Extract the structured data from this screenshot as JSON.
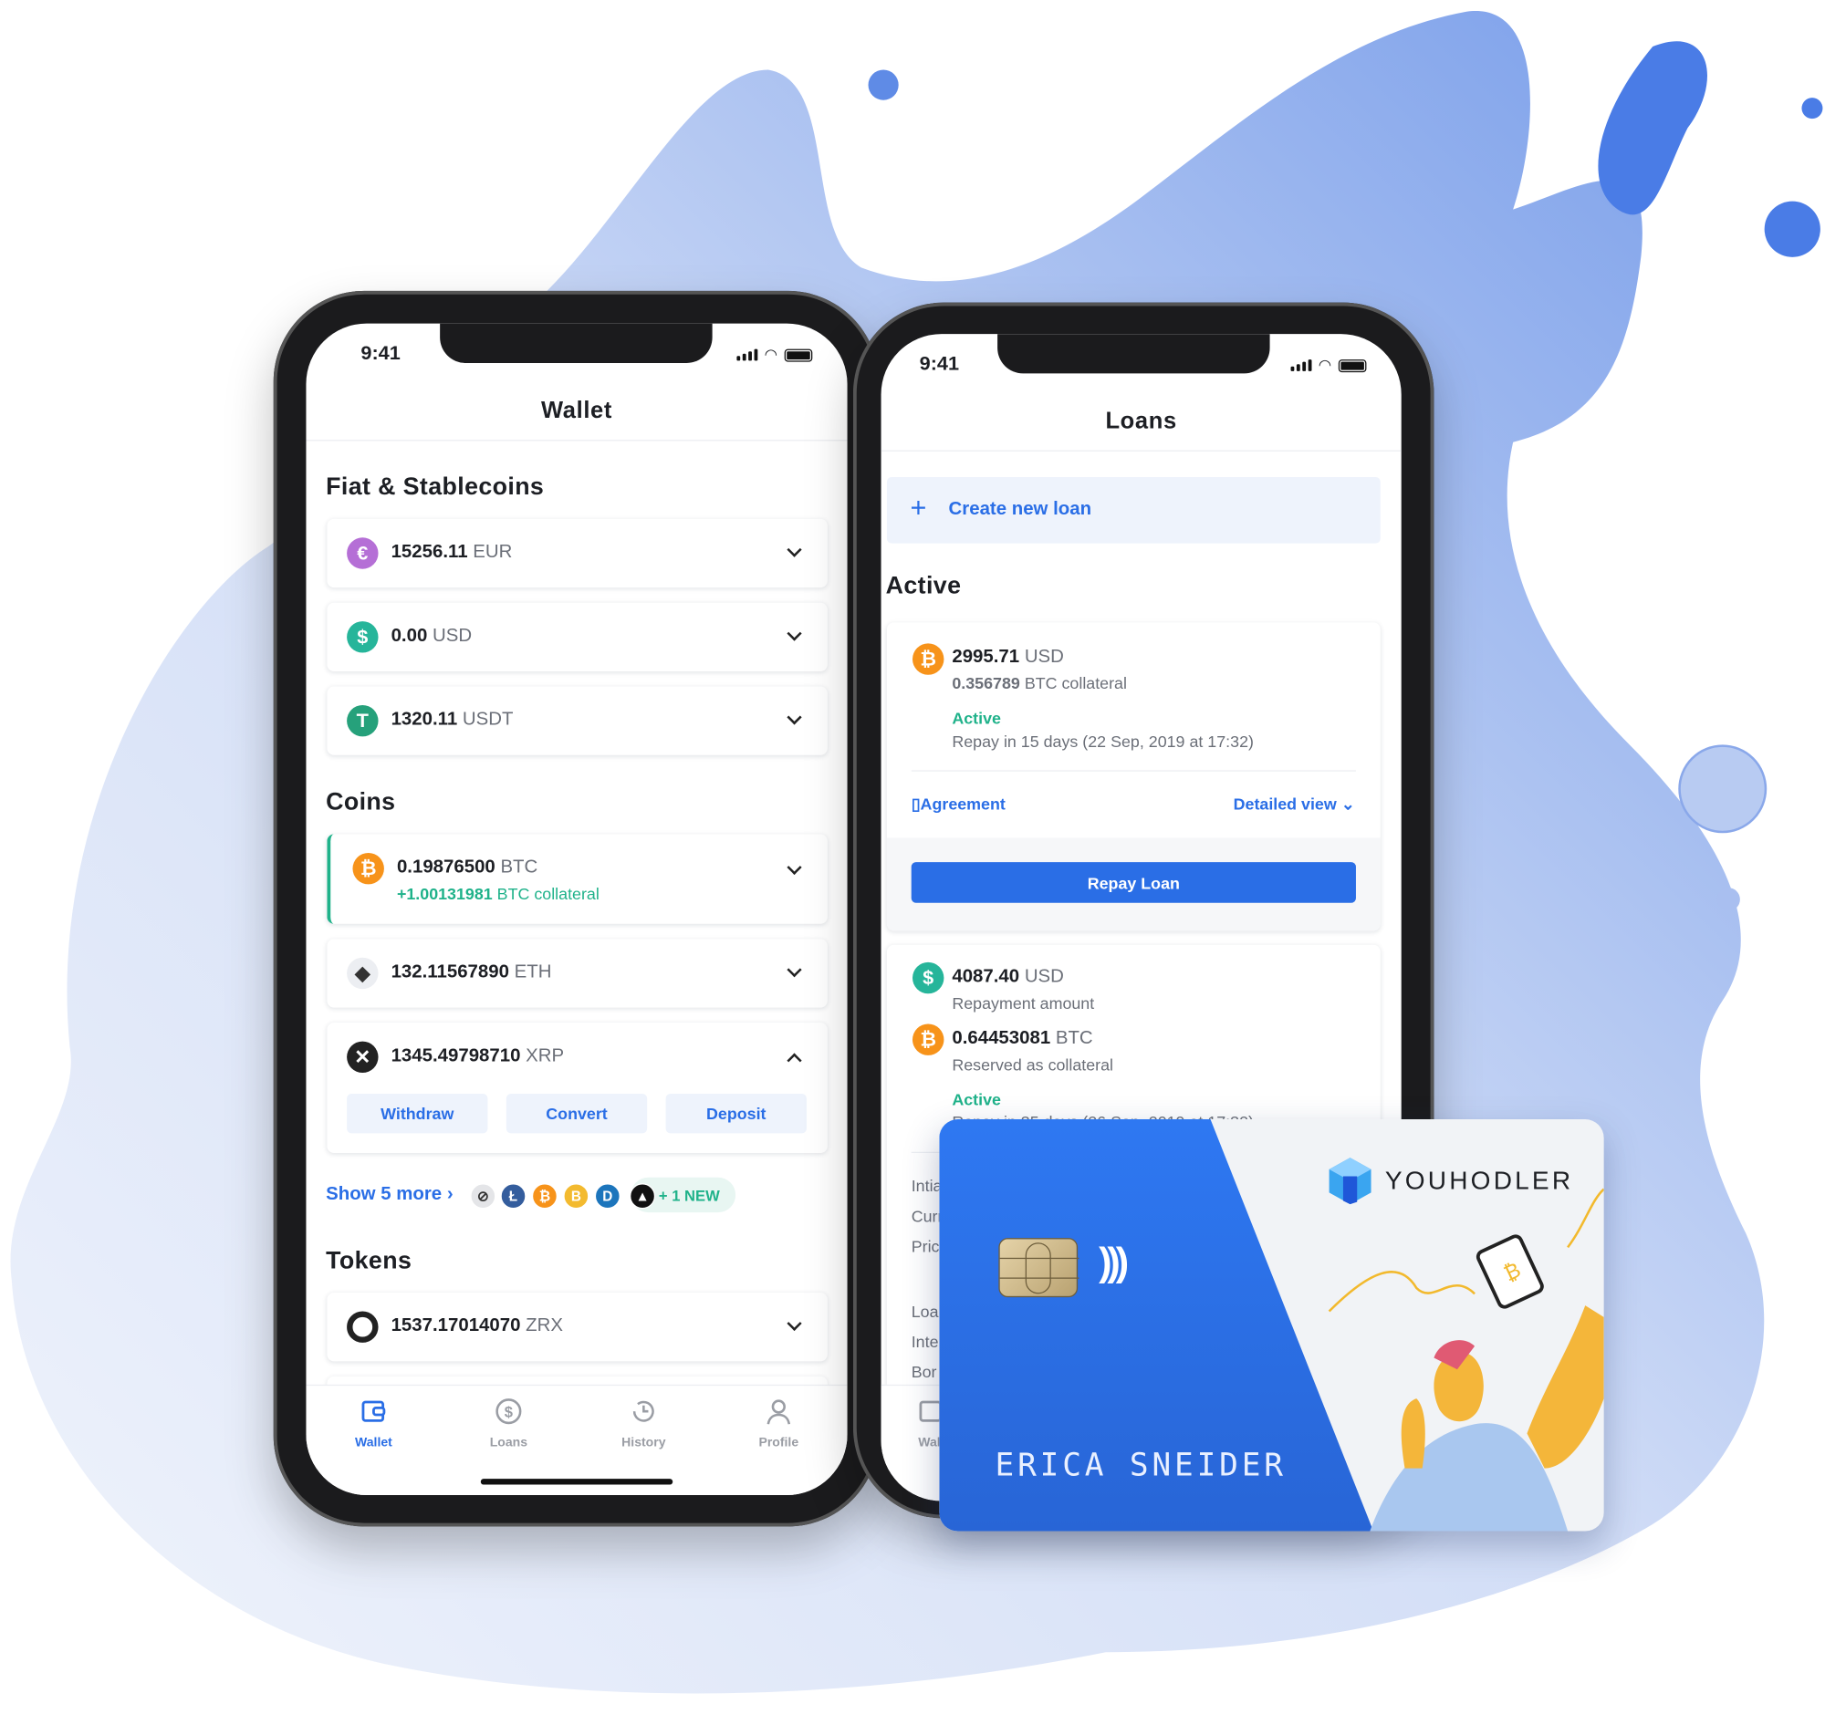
{
  "colors": {
    "accent": "#2a6ee6",
    "positive": "#1fb28a",
    "card_blue": "#2b71ea",
    "btc": "#f7931a",
    "usd": "#26b59a",
    "eur": "#b56fd6",
    "usdt": "#26a17b"
  },
  "wallet_phone": {
    "status_time": "9:41",
    "title": "Wallet",
    "sections": {
      "fiat": "Fiat & Stablecoins",
      "coins": "Coins",
      "tokens": "Tokens"
    },
    "fiat": [
      {
        "amount": "15256.11",
        "unit": "EUR",
        "icon": "euro-icon"
      },
      {
        "amount": "0.00",
        "unit": "USD",
        "icon": "dollar-icon"
      },
      {
        "amount": "1320.11",
        "unit": "USDT",
        "icon": "tether-icon"
      }
    ],
    "coins": [
      {
        "amount": "0.19876500",
        "unit": "BTC",
        "sub_amount": "+1.00131981",
        "sub_text": "BTC collateral",
        "icon": "bitcoin-icon"
      },
      {
        "amount": "132.11567890",
        "unit": "ETH",
        "icon": "ethereum-icon"
      },
      {
        "amount": "1345.49798710",
        "unit": "XRP",
        "icon": "ripple-icon",
        "expanded": true,
        "actions": [
          "Withdraw",
          "Convert",
          "Deposit"
        ]
      }
    ],
    "show_more": "Show 5 more",
    "more_coin_icons": [
      "stellar-icon",
      "litecoin-icon",
      "bitcoin-cash-icon",
      "binance-coin-icon",
      "dash-icon",
      "eos-icon"
    ],
    "new_badge": "+ 1 NEW",
    "tokens": [
      {
        "amount": "1537.17014070",
        "unit": "ZRX",
        "icon": "zrx-icon"
      }
    ],
    "tabs": [
      {
        "label": "Wallet",
        "active": true
      },
      {
        "label": "Loans"
      },
      {
        "label": "History"
      },
      {
        "label": "Profile"
      }
    ]
  },
  "loans_phone": {
    "status_time": "9:41",
    "title": "Loans",
    "create_loan": "Create new loan",
    "section": "Active",
    "loan1": {
      "amount": "2995.71",
      "unit": "USD",
      "collateral_amount": "0.356789",
      "collateral_text": "BTC collateral",
      "status": "Active",
      "repay": "Repay in 15 days (22 Sep, 2019 at 17:32)",
      "agreement": "Agreement",
      "detailed_view": "Detailed view",
      "repay_button": "Repay Loan"
    },
    "loan2": {
      "amount": "4087.40",
      "unit": "USD",
      "amount_label": "Repayment amount",
      "collateral_amount": "0.64453081",
      "collateral_unit": "BTC",
      "collateral_label": "Reserved as collateral",
      "status": "Active",
      "repay": "Repay in 35 days (26 Sep, 2019 at 17:32)"
    },
    "detail_labels": [
      "Intia",
      "Curr",
      "Pric",
      "Loa",
      "Inte",
      "Bor"
    ],
    "tab_partial": "Wall"
  },
  "bank_card": {
    "brand": "YOUHODLER",
    "holder": "ERICA SNEIDER"
  }
}
